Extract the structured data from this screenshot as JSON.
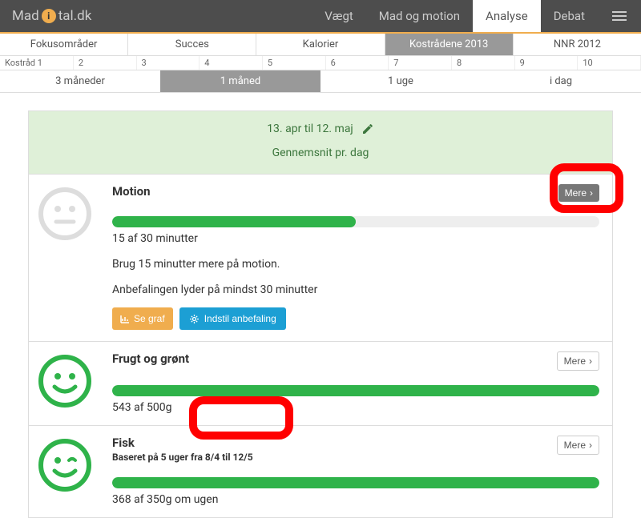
{
  "logo": {
    "pre": "Mad",
    "post": "tal.dk"
  },
  "nav": [
    {
      "label": "Vægt",
      "active": false
    },
    {
      "label": "Mad og motion",
      "active": false
    },
    {
      "label": "Analyse",
      "active": true
    },
    {
      "label": "Debat",
      "active": false
    }
  ],
  "tabs_primary": [
    {
      "label": "Fokusområder"
    },
    {
      "label": "Succes"
    },
    {
      "label": "Kalorier"
    },
    {
      "label": "Kostrådene 2013",
      "active": true
    },
    {
      "label": "NNR 2012"
    }
  ],
  "numbers": [
    "Kostråd 1",
    "2",
    "3",
    "4",
    "5",
    "6",
    "7",
    "8",
    "9",
    "10"
  ],
  "time_tabs": [
    {
      "label": "3 måneder"
    },
    {
      "label": "1 måned",
      "active": true
    },
    {
      "label": "1 uge"
    },
    {
      "label": "i dag"
    }
  ],
  "header": {
    "date_range": "13. apr til 12. maj",
    "avg_label": "Gennemsnit pr. dag"
  },
  "more_label": "Mere",
  "sections": {
    "motion": {
      "title": "Motion",
      "progress_pct": 50,
      "caption": "15 af 30 minutter",
      "line1": "Brug 15 minutter mere på motion.",
      "line2": "Anbefalingen lyder på mindst 30 minutter",
      "btn_graph": "Se graf",
      "btn_settings": "Indstil anbefaling"
    },
    "frugt": {
      "title": "Frugt og grønt",
      "progress_pct": 100,
      "caption": "543 af 500g"
    },
    "fisk": {
      "title": "Fisk",
      "subtitle": "Baseret på 5 uger fra 8/4 til 12/5",
      "progress_pct": 100,
      "caption": "368 af 350g om ugen"
    }
  }
}
